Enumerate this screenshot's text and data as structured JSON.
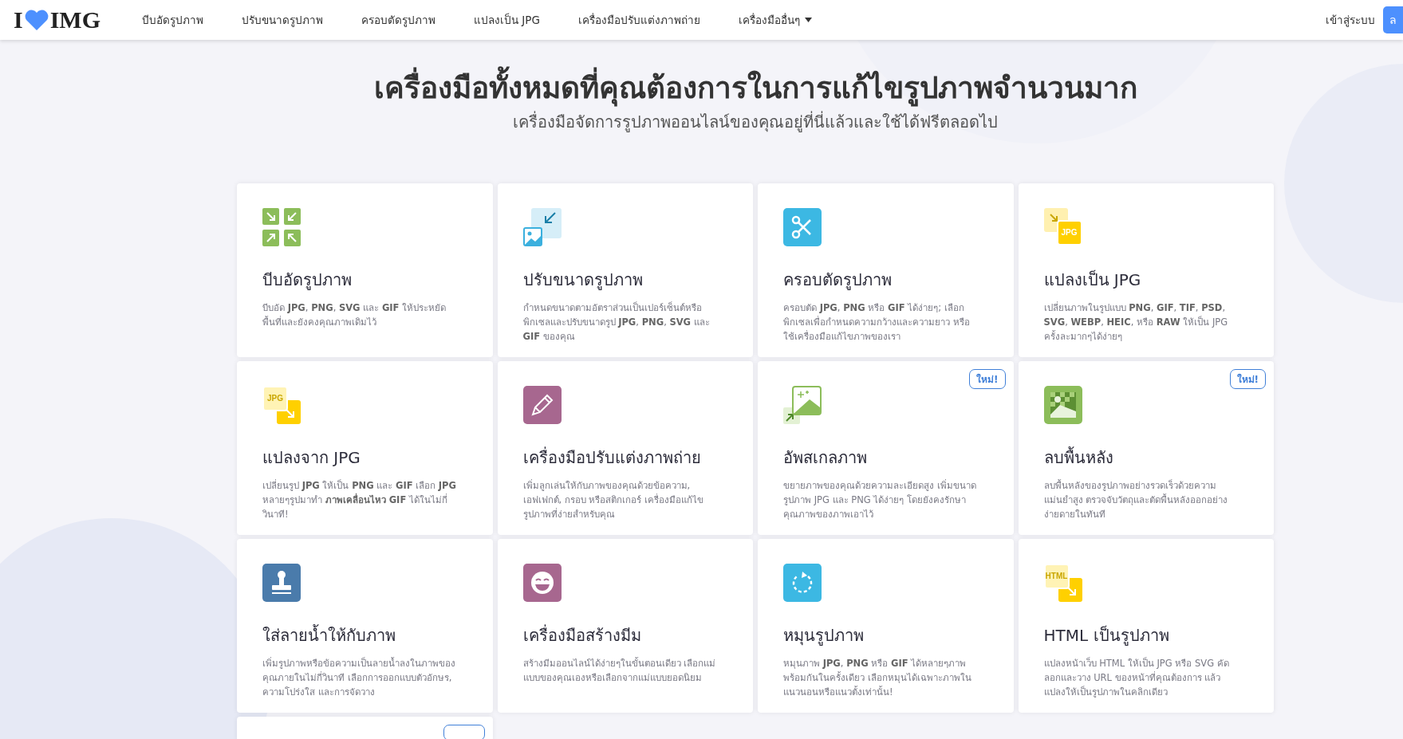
{
  "header": {
    "logo": {
      "left": "I",
      "right": "IMG"
    },
    "nav": [
      {
        "label": "บีบอัดรูปภาพ",
        "dropdown": false
      },
      {
        "label": "ปรับขนาดรูปภาพ",
        "dropdown": false
      },
      {
        "label": "ครอบตัดรูปภาพ",
        "dropdown": false
      },
      {
        "label": "แปลงเป็น JPG",
        "dropdown": false
      },
      {
        "label": "เครื่องมือปรับแต่งภาพถ่าย",
        "dropdown": false
      },
      {
        "label": "เครื่องมืออื่นๆ",
        "dropdown": true
      }
    ],
    "login": "เข้าสู่ระบบ",
    "signup": "ล"
  },
  "hero": {
    "title": "เครื่องมือทั้งหมดที่คุณต้องการในการแก้ไขรูปภาพจำนวนมาก",
    "subtitle": "เครื่องมือจัดการรูปภาพออนไลน์ของคุณอยู่ที่นี่แล้วและใช้ได้ฟรีตลอดไป"
  },
  "tools": [
    {
      "title": "บีบอัดรูปภาพ",
      "description": "บีบอัด **JPG**, **PNG**, **SVG** และ **GIF** ให้ประหยัดพื้นที่และยังคงคุณภาพเดิมไว้",
      "new": false
    },
    {
      "title": "ปรับขนาดรูปภาพ",
      "description": "กำหนดขนาดตามอัตราส่วนเป็นเปอร์เซ็นต์หรือพิกเซลและปรับขนาดรูป **JPG**, **PNG**, **SVG** และ **GIF** ของคุณ",
      "new": false
    },
    {
      "title": "ครอบตัดรูปภาพ",
      "description": "ครอบตัด **JPG**, **PNG** หรือ **GIF** ได้ง่ายๆ; เลือกพิกเซลเพื่อกำหนดความกว้างและความยาว หรือใช้เครื่องมือแก้ไขภาพของเรา",
      "new": false
    },
    {
      "title": "แปลงเป็น JPG",
      "description": "เปลี่ยนภาพในรูปแบบ **PNG**, **GIF**, **TIF**, **PSD**, **SVG**, **WEBP**, **HEIC**, หรือ **RAW** ให้เป็น JPG ครั้งละมากๆได้ง่ายๆ",
      "new": false,
      "icon_label": "JPG"
    },
    {
      "title": "แปลงจาก JPG",
      "description": "เปลี่ยนรูป **JPG** ให้เป็น **PNG** และ **GIF** เลือก **JPG** หลายๆรูปมาทำ **ภาพเคลื่อนไหว GIF** ได้ในไม่กี่วินาที!",
      "new": false,
      "icon_label": "JPG"
    },
    {
      "title": "เครื่องมือปรับแต่งภาพถ่าย",
      "description": "เพิ่มลูกเล่นให้กับภาพของคุณด้วยข้อความ, เอฟเฟกต์, กรอบ หรือสติกเกอร์ เครื่องมือแก้ไขรูปภาพที่ง่ายสำหรับคุณ",
      "new": false
    },
    {
      "title": "อัพสเกลภาพ",
      "description": "ขยายภาพของคุณด้วยความละเอียดสูง เพิ่มขนาดรูปภาพ JPG และ PNG ได้ง่ายๆ โดยยังคงรักษาคุณภาพของภาพเอาไว้",
      "new": true,
      "badge": "ใหม่!"
    },
    {
      "title": "ลบพื้นหลัง",
      "description": "ลบพื้นหลังของรูปภาพอย่างรวดเร็วด้วยความแม่นยำสูง ตรวจจับวัตถุและตัดพื้นหลังออกอย่างง่ายดายในทันที",
      "new": true,
      "badge": "ใหม่!"
    },
    {
      "title": "ใส่ลายน้ำให้กับภาพ",
      "description": "เพิ่มรูปภาพหรือข้อความเป็นลายน้ำลงในภาพของคุณภายในไม่กี่วินาที เลือกการออกแบบตัวอักษร, ความโปร่งใส และการจัดวาง",
      "new": false
    },
    {
      "title": "เครื่องมือสร้างมีม",
      "description": "สร้างมีมออนไลน์ได้ง่ายๆในขั้นตอนเดียว เลือกแม่แบบของคุณเองหรือเลือกจากแม่แบบยอดนิยม",
      "new": false
    },
    {
      "title": "หมุนรูปภาพ",
      "description": "หมุนภาพ **JPG**, **PNG** หรือ **GIF** ได้หลายๆภาพพร้อมกันในครั้งเดียว เลือกหมุนได้เฉพาะภาพในแนวนอนหรือแนวตั้งเท่านั้น!",
      "new": false
    },
    {
      "title": "HTML เป็นรูปภาพ",
      "description": "แปลงหน้าเว็บ HTML ให้เป็น JPG หรือ SVG คัดลอกและวาง URL ของหน้าที่คุณต้องการ แล้วแปลงให้เป็นรูปภาพในคลิกเดียว",
      "new": false,
      "icon_label": "HTML"
    }
  ],
  "partial_cards": [
    {
      "new": true
    }
  ]
}
